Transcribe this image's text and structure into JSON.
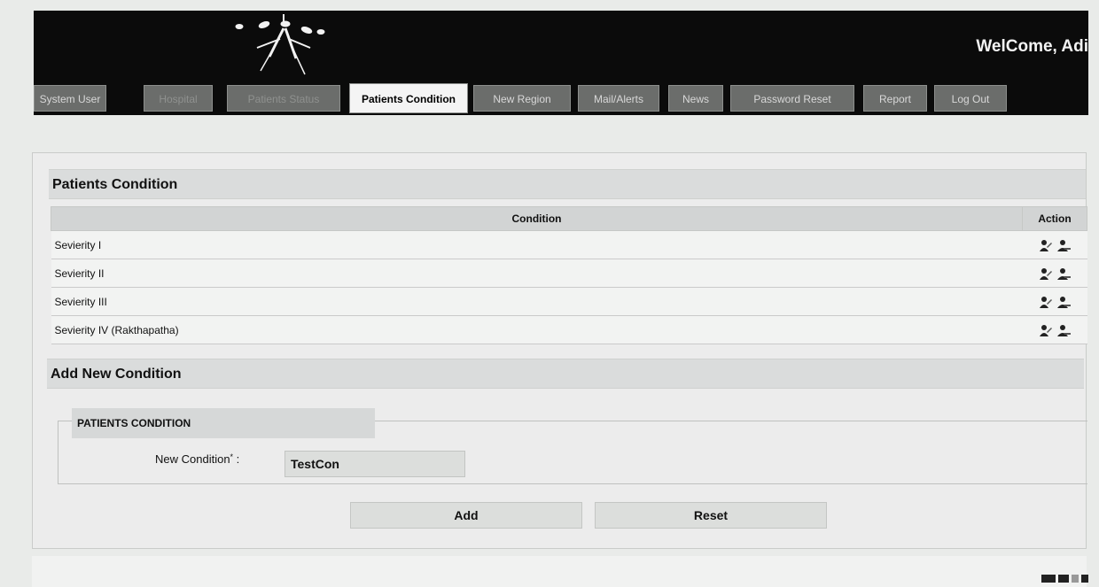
{
  "header": {
    "welcome": "WelCome, Adi"
  },
  "tabs": [
    {
      "label": "System User"
    },
    {
      "label": "Hospital"
    },
    {
      "label": "Patients Status"
    },
    {
      "label": "Patients Condition"
    },
    {
      "label": "New Region"
    },
    {
      "label": "Mail/Alerts"
    },
    {
      "label": "News"
    },
    {
      "label": "Password Reset"
    },
    {
      "label": "Report"
    },
    {
      "label": "Log Out"
    }
  ],
  "conditions": {
    "title": "Patients Condition",
    "columns": {
      "condition": "Condition",
      "action": "Action"
    },
    "rows": [
      {
        "condition": "Sevierity I"
      },
      {
        "condition": "Sevierity II"
      },
      {
        "condition": "Sevierity III"
      },
      {
        "condition": "Sevierity IV (Rakthapatha)"
      }
    ],
    "action_icons": [
      "edit-user-icon",
      "delete-user-icon"
    ]
  },
  "add_form": {
    "title": "Add New Condition",
    "legend": "PATIENTS CONDITION",
    "field_label": "New Condition",
    "required_marker": "*",
    "field_value": "TestCon",
    "add_button": "Add",
    "reset_button": "Reset"
  }
}
